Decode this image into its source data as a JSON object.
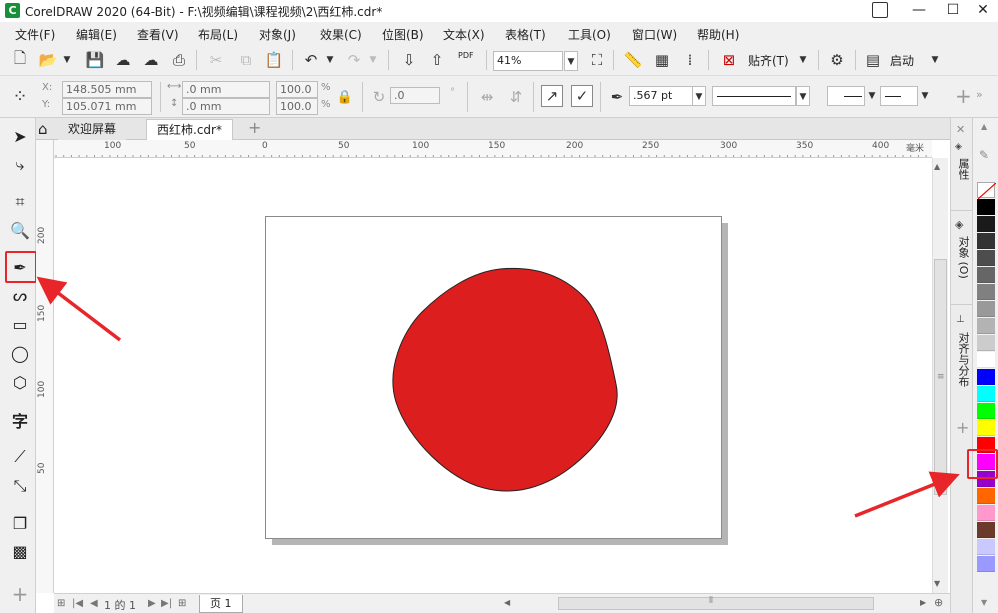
{
  "titlebar": {
    "logo_glyph": "C",
    "title": "CorelDRAW 2020 (64-Bit) - F:\\视频编辑\\课程视频\\2\\西红柿.cdr*"
  },
  "menu": [
    "文件(F)",
    "编辑(E)",
    "查看(V)",
    "布局(L)",
    "对象(J)",
    "效果(C)",
    "位图(B)",
    "文本(X)",
    "表格(T)",
    "工具(O)",
    "窗口(W)",
    "帮助(H)"
  ],
  "toolbar1": {
    "pdf_label": "PDF",
    "zoom_value": "41%",
    "snap_label": "贴齐(T)",
    "launch_label": "启动"
  },
  "toolbar2": {
    "x_label": "X:",
    "y_label": "Y:",
    "x_value": "148.505 mm",
    "y_value": "105.071 mm",
    "w_value": ".0 mm",
    "h_value": ".0 mm",
    "scale_w": "100.0",
    "scale_h": "100.0",
    "pct": "%",
    "rotation": ".0",
    "outline_width": ".567 pt"
  },
  "tabs": {
    "welcome": "欢迎屏幕",
    "document": "西红柿.cdr*",
    "add": "+"
  },
  "ruler": {
    "h_labels": [
      "100",
      "50",
      "0",
      "50",
      "100",
      "150",
      "200",
      "250",
      "300",
      "350",
      "400"
    ],
    "unit": "毫米",
    "v_labels": [
      "200",
      "150",
      "100",
      "50"
    ]
  },
  "docker": {
    "properties": "属性",
    "objects": "对象 (O)",
    "align": "对齐与分布"
  },
  "status": {
    "page_info": "1 的 1",
    "page_tab": "页 1"
  },
  "shape": {
    "fill": "#dc1e1e",
    "outline": "#222222"
  },
  "palette": [
    "#ffffff",
    "#000000",
    "#1a1a1a",
    "#333333",
    "#4d4d4d",
    "#666666",
    "#808080",
    "#999999",
    "#b3b3b3",
    "#cccccc",
    "#ffffff",
    "#0000ff",
    "#00ffff",
    "#00ff00",
    "#ffff00",
    "#ff0000",
    "#ff00ff",
    "#9900cc",
    "#ff6600",
    "#ff99cc",
    "#6b3a2a",
    "#c9c9ff",
    "#9999ff"
  ],
  "colors": {
    "accent_red": "#e8262a",
    "page_shadow": "#b5b5b5"
  }
}
